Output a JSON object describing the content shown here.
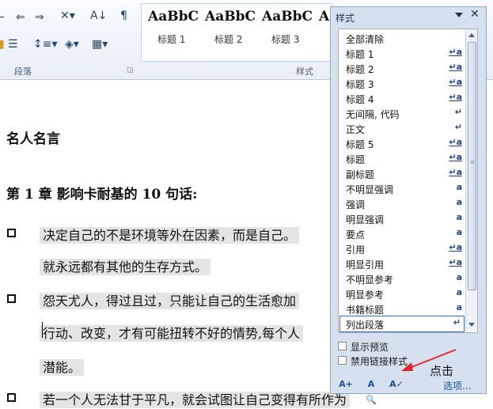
{
  "ribbon": {
    "paragraph_group_label": "段落",
    "styles_group_label": "样式",
    "gallery": [
      {
        "sample": "AaBbC",
        "name": "标题 1"
      },
      {
        "sample": "AaBbC",
        "name": "标题 2"
      },
      {
        "sample": "AaBbC",
        "name": "标题 3"
      },
      {
        "sample": "A",
        "name": ""
      }
    ]
  },
  "document": {
    "title": "名人名言",
    "chapter": "第 1 章  影响卡耐基的 10 句话:",
    "paragraphs": [
      "决定自己的不是环境等外在因素，而是自己。",
      "就永远都有其他的生存方式。",
      "怨天尤人，得过且过，只能让自己的生活愈加",
      "行动、改变，才有可能扭转不好的情势,每个人",
      "潜能。",
      "若一个人无法甘于平凡，就会试图让自己变得有所作为"
    ]
  },
  "styles_pane": {
    "title": "样式",
    "items": [
      {
        "label": "全部清除",
        "mark": ""
      },
      {
        "label": "标题 1",
        "mark": "↵a"
      },
      {
        "label": "标题 2",
        "mark": "↵a"
      },
      {
        "label": "标题 3",
        "mark": "↵a"
      },
      {
        "label": "标题 4",
        "mark": "↵a"
      },
      {
        "label": "无间隔, 代码",
        "mark": "↵"
      },
      {
        "label": "正文",
        "mark": "↵"
      },
      {
        "label": "标题 5",
        "mark": "↵a"
      },
      {
        "label": "标题",
        "mark": "↵a"
      },
      {
        "label": "副标题",
        "mark": "↵a"
      },
      {
        "label": "不明显强调",
        "mark": "a"
      },
      {
        "label": "强调",
        "mark": "a"
      },
      {
        "label": "明显强调",
        "mark": "a"
      },
      {
        "label": "要点",
        "mark": "a"
      },
      {
        "label": "引用",
        "mark": "↵a"
      },
      {
        "label": "明显引用",
        "mark": "↵a"
      },
      {
        "label": "不明显参考",
        "mark": "a"
      },
      {
        "label": "明显参考",
        "mark": "a"
      },
      {
        "label": "书籍标题",
        "mark": "a"
      },
      {
        "label": "列出段落",
        "mark": "↵"
      }
    ],
    "show_preview": "显示预览",
    "disable_linked": "禁用链接样式",
    "options_link": "选项...",
    "selected_item": "列出段落"
  },
  "annotation": "点击",
  "colors": {
    "accent": "#1f4fa8",
    "annotation_arrow": "#e3262b"
  }
}
